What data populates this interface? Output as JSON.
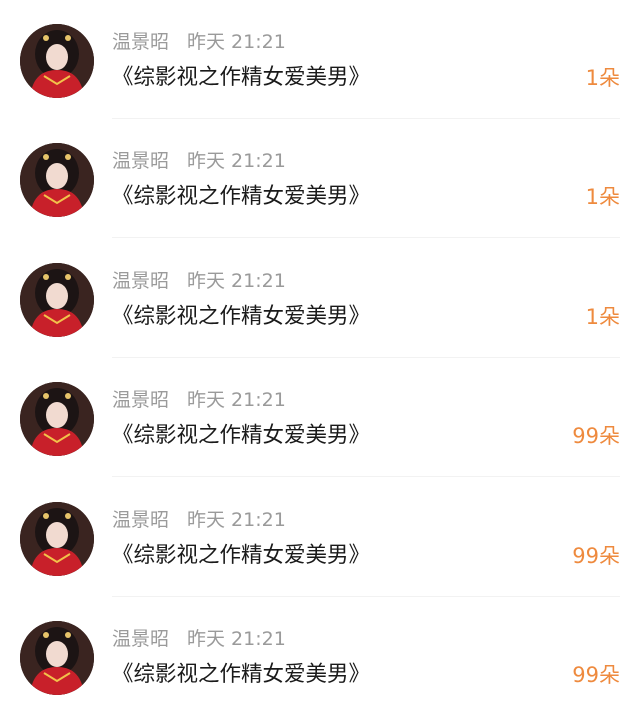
{
  "items": [
    {
      "user": "温景昭",
      "time": "昨天 21:21",
      "title": "《综影视之作精女爱美男》",
      "count": "1朵"
    },
    {
      "user": "温景昭",
      "time": "昨天 21:21",
      "title": "《综影视之作精女爱美男》",
      "count": "1朵"
    },
    {
      "user": "温景昭",
      "time": "昨天 21:21",
      "title": "《综影视之作精女爱美男》",
      "count": "1朵"
    },
    {
      "user": "温景昭",
      "time": "昨天 21:21",
      "title": "《综影视之作精女爱美男》",
      "count": "99朵"
    },
    {
      "user": "温景昭",
      "time": "昨天 21:21",
      "title": "《综影视之作精女爱美男》",
      "count": "99朵"
    },
    {
      "user": "温景昭",
      "time": "昨天 21:21",
      "title": "《综影视之作精女爱美男》",
      "count": "99朵"
    }
  ],
  "colors": {
    "meta_text": "#9a9a9a",
    "title_text": "#1a1a1a",
    "count_text": "#ee8a3e",
    "divider": "#f2f2f2"
  },
  "icons": {
    "avatar": "user-avatar-photo"
  }
}
